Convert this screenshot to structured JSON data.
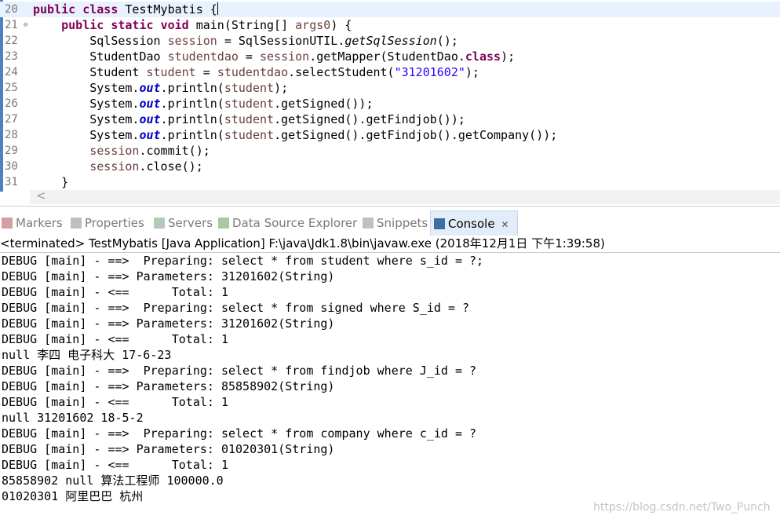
{
  "editor": {
    "lines": [
      {
        "num": "20",
        "current": true,
        "tokens": [
          [
            "kw",
            "public"
          ],
          [
            "t",
            " "
          ],
          [
            "kw",
            "class"
          ],
          [
            "t",
            " TestMybatis {"
          ]
        ],
        "caret": true
      },
      {
        "num": "21",
        "fold": "⊖",
        "tokens": [
          [
            "t",
            "    "
          ],
          [
            "kw",
            "public"
          ],
          [
            "t",
            " "
          ],
          [
            "kw",
            "static"
          ],
          [
            "t",
            " "
          ],
          [
            "kw",
            "void"
          ],
          [
            "t",
            " main(String[] "
          ],
          [
            "var",
            "args0"
          ],
          [
            "t",
            ") {"
          ]
        ]
      },
      {
        "num": "22",
        "tokens": [
          [
            "t",
            "        SqlSession "
          ],
          [
            "var",
            "session"
          ],
          [
            "t",
            " = SqlSessionUTIL."
          ],
          [
            "mth",
            "getSqlSession"
          ],
          [
            "t",
            "();"
          ]
        ]
      },
      {
        "num": "23",
        "tokens": [
          [
            "t",
            "        StudentDao "
          ],
          [
            "var",
            "studentdao"
          ],
          [
            "t",
            " = "
          ],
          [
            "var",
            "session"
          ],
          [
            "t",
            ".getMapper(StudentDao."
          ],
          [
            "kw",
            "class"
          ],
          [
            "t",
            ");"
          ]
        ]
      },
      {
        "num": "24",
        "tokens": [
          [
            "t",
            "        Student "
          ],
          [
            "var",
            "student"
          ],
          [
            "t",
            " = "
          ],
          [
            "var",
            "studentdao"
          ],
          [
            "t",
            ".selectStudent("
          ],
          [
            "str",
            "\"31201602\""
          ],
          [
            "t",
            ");"
          ]
        ]
      },
      {
        "num": "25",
        "tokens": [
          [
            "t",
            "        System."
          ],
          [
            "fld",
            "out"
          ],
          [
            "t",
            ".println("
          ],
          [
            "var",
            "student"
          ],
          [
            "t",
            ");"
          ]
        ]
      },
      {
        "num": "26",
        "tokens": [
          [
            "t",
            "        System."
          ],
          [
            "fld",
            "out"
          ],
          [
            "t",
            ".println("
          ],
          [
            "var",
            "student"
          ],
          [
            "t",
            ".getSigned());"
          ]
        ]
      },
      {
        "num": "27",
        "tokens": [
          [
            "t",
            "        System."
          ],
          [
            "fld",
            "out"
          ],
          [
            "t",
            ".println("
          ],
          [
            "var",
            "student"
          ],
          [
            "t",
            ".getSigned().getFindjob());"
          ]
        ]
      },
      {
        "num": "28",
        "tokens": [
          [
            "t",
            "        System."
          ],
          [
            "fld",
            "out"
          ],
          [
            "t",
            ".println("
          ],
          [
            "var",
            "student"
          ],
          [
            "t",
            ".getSigned().getFindjob().getCompany());"
          ]
        ]
      },
      {
        "num": "29",
        "tokens": [
          [
            "t",
            "        "
          ],
          [
            "var",
            "session"
          ],
          [
            "t",
            ".commit();"
          ]
        ]
      },
      {
        "num": "30",
        "tokens": [
          [
            "t",
            "        "
          ],
          [
            "var",
            "session"
          ],
          [
            "t",
            ".close();"
          ]
        ]
      },
      {
        "num": "31",
        "tokens": [
          [
            "t",
            "    }"
          ]
        ]
      }
    ],
    "scroll_left_arrow": "<"
  },
  "views": {
    "tabs": [
      {
        "label": "Markers",
        "icon": "markers-icon",
        "color": "#b05050"
      },
      {
        "label": "Properties",
        "icon": "properties-icon",
        "color": "#8a8a8a"
      },
      {
        "label": "Servers",
        "icon": "servers-icon",
        "color": "#7a9a7a"
      },
      {
        "label": "Data Source Explorer",
        "icon": "data-source-explorer-icon",
        "color": "#6a9a4a"
      },
      {
        "label": "Snippets",
        "icon": "snippets-icon",
        "color": "#8a8aa0"
      },
      {
        "label": "Console",
        "icon": "console-icon",
        "color": "#3a6ea5",
        "active": true
      }
    ],
    "close_glyph": "✕"
  },
  "console": {
    "header": "<terminated> TestMybatis [Java Application] F:\\java\\Jdk1.8\\bin\\javaw.exe (2018年12月1日 下午1:39:58)",
    "lines": [
      "DEBUG [main] - ==>  Preparing: select * from student where s_id = ?;",
      "DEBUG [main] - ==> Parameters: 31201602(String)",
      "DEBUG [main] - <==      Total: 1",
      "DEBUG [main] - ==>  Preparing: select * from signed where S_id = ?",
      "DEBUG [main] - ==> Parameters: 31201602(String)",
      "DEBUG [main] - <==      Total: 1",
      "null 李四 电子科大 17-6-23",
      "DEBUG [main] - ==>  Preparing: select * from findjob where J_id = ?",
      "DEBUG [main] - ==> Parameters: 85858902(String)",
      "DEBUG [main] - <==      Total: 1",
      "null 31201602 18-5-2",
      "DEBUG [main] - ==>  Preparing: select * from company where c_id = ?",
      "DEBUG [main] - ==> Parameters: 01020301(String)",
      "DEBUG [main] - <==      Total: 1",
      "85858902 null 算法工程师 100000.0",
      "01020301 阿里巴巴 杭州"
    ]
  },
  "watermark": "https://blog.csdn.net/Two_Punch"
}
